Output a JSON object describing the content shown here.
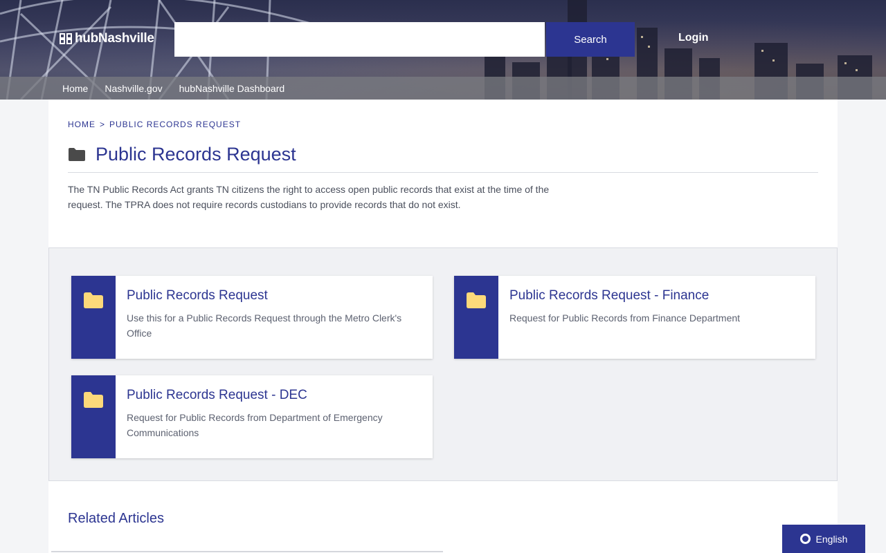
{
  "header": {
    "logo_text": "hubNashville",
    "search_placeholder": "",
    "search_label": "Search",
    "login_label": "Login"
  },
  "nav": {
    "items": [
      "Home",
      "Nashville.gov",
      "hubNashville Dashboard"
    ]
  },
  "breadcrumb": {
    "home": "HOME",
    "separator": ">",
    "current": "PUBLIC RECORDS REQUEST"
  },
  "page": {
    "title": "Public Records Request",
    "description": "The TN Public Records Act grants TN citizens the right to access open public records that exist at the time of the request. The TPRA does not require records custodians to provide records that do not exist."
  },
  "cards": [
    {
      "title": "Public Records Request",
      "description": "Use this for a Public Records Request through the Metro Clerk's Office"
    },
    {
      "title": "Public Records Request - Finance",
      "description": "Request for Public Records from Finance Department"
    },
    {
      "title": "Public Records Request - DEC",
      "description": "Request for Public Records from Department of Emergency Communications"
    }
  ],
  "related": {
    "title": "Related Articles"
  },
  "language": {
    "label": "English"
  },
  "colors": {
    "brand": "#2c3591",
    "folder_card_icon": "#fcd97a",
    "folder_title_icon": "#4a4a4a"
  },
  "icons": {
    "card": "folder-icon",
    "title": "folder-icon",
    "language": "globe-ring-icon"
  }
}
